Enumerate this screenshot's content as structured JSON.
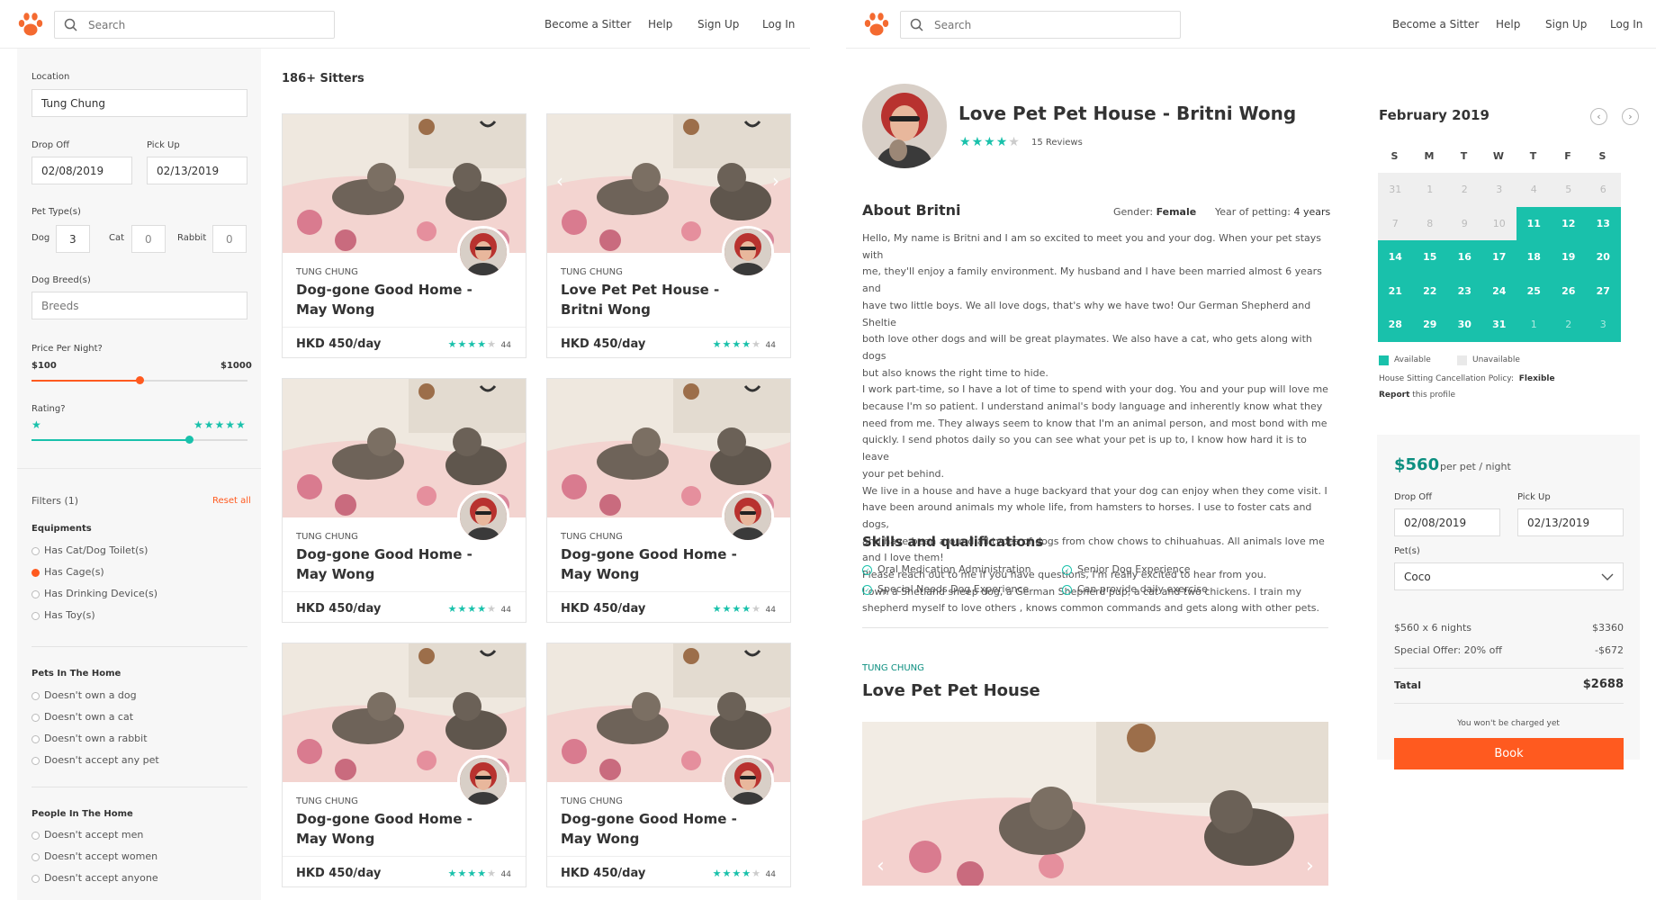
{
  "colors": {
    "accent": "#ff5a1f",
    "teal": "#19c1ab",
    "brand_orange": "#f46a30"
  },
  "header": {
    "search_placeholder": "Search",
    "nav": [
      "Become a Sitter",
      "Help",
      "Sign Up",
      "Log In"
    ]
  },
  "filters": {
    "location_label": "Location",
    "location_value": "Tung Chung",
    "dropoff_label": "Drop Off",
    "dropoff_value": "02/08/2019",
    "pickup_label": "Pick Up",
    "pickup_value": "02/13/2019",
    "pet_types_label": "Pet Type(s)",
    "dog_label": "Dog",
    "dog_count": "3",
    "cat_label": "Cat",
    "cat_count": "0",
    "rabbit_label": "Rabbit",
    "rabbit_count": "0",
    "breeds_label": "Dog Breed(s)",
    "breeds_placeholder": "Breeds",
    "price_label": "Price Per Night?",
    "price_min": "$100",
    "price_max": "$1000",
    "price_fraction": 0.5,
    "rating_label": "Rating?",
    "rating_fraction": 0.73,
    "filters_count": "Filters (1)",
    "reset": "Reset all",
    "equipments_label": "Equipments",
    "equipments": [
      "Has Cat/Dog Toilet(s)",
      "Has Cage(s)",
      "Has Drinking Device(s)",
      "Has Toy(s)"
    ],
    "equipments_selected": 1,
    "pets_label": "Pets In The Home",
    "pets": [
      "Doesn't own a dog",
      "Doesn't own a cat",
      "Doesn't own a rabbit",
      "Doesn't accept any pet"
    ],
    "people_label": "People In The Home",
    "people": [
      "Doesn't accept men",
      "Doesn't accept women",
      "Doesn't accept anyone"
    ]
  },
  "results": {
    "count": "186+ Sitters",
    "cards": [
      {
        "location": "TUNG CHUNG",
        "title": "Dog-gone Good Home - May Wong",
        "price": "HKD 450/day",
        "reviews": "44",
        "rating": 4
      },
      {
        "location": "TUNG CHUNG",
        "title": "Love Pet Pet House - Britni Wong",
        "price": "HKD 450/day",
        "reviews": "44",
        "rating": 4
      },
      {
        "location": "TUNG CHUNG",
        "title": "Dog-gone Good Home - May Wong",
        "price": "HKD 450/day",
        "reviews": "44",
        "rating": 4
      },
      {
        "location": "TUNG CHUNG",
        "title": "Dog-gone Good Home - May Wong",
        "price": "HKD 450/day",
        "reviews": "44",
        "rating": 4
      },
      {
        "location": "TUNG CHUNG",
        "title": "Dog-gone Good Home - May Wong",
        "price": "HKD 450/day",
        "reviews": "44",
        "rating": 4
      },
      {
        "location": "TUNG CHUNG",
        "title": "Dog-gone Good Home - May Wong",
        "price": "HKD 450/day",
        "reviews": "44",
        "rating": 4
      }
    ]
  },
  "profile": {
    "name": "Love Pet Pet House - Britni Wong",
    "reviews": "15 Reviews",
    "rating": 4,
    "about_title": "About Britni",
    "gender_label": "Gender:",
    "gender_value": "Female",
    "years_label": "Year of petting:",
    "years_value": "4 years",
    "about_lines": [
      "Hello, My name is Britni and I am so excited to meet you and your dog. When your pet stays with",
      "me, they'll enjoy a family environment. My husband and I have been married almost 6 years and",
      "have two little boys. We all love dogs, that's why we have two! Our German Shepherd and Sheltie",
      "both love other dogs and will be great playmates. We also have a cat, who gets along with dogs",
      "but also knows the right time to hide.",
      "I work part-time, so I have a lot of time to spend with your dog. You and your pup will love me",
      "because I'm so patient. I understand animal's body language and inherently know what they",
      "need from me. They always seem to know that I'm an animal person, and most bond with me",
      "quickly. I send photos daily so you can see what your pet is up to, I know how hard it is to leave",
      "your pet behind.",
      "We live in a house and have a huge backyard that your dog can enjoy when they come visit. I",
      "have been around animals my whole life, from hamsters to horses. I use to foster cats and dogs,",
      "and have been around all types of dogs from chow chows to chihuahuas. All animals love me",
      "and I love them!",
      "Please reach out to me if you have questions, I'm really excited to hear from you.",
      "I own a Shetland sheep dog, a German Shepherd pup, a cat and two chickens. I train my",
      "shepherd myself to love others , knows common commands and gets along with other pets."
    ],
    "skills_title": "Skills and qualifications",
    "skills": [
      "Oral Medication Administration",
      "Special Needs Dog Experience",
      "Senior Dog Experience",
      "Can provide daily exercise"
    ],
    "house_location": "TUNG CHUNG",
    "house_title": "Love Pet Pet House"
  },
  "calendar": {
    "month": "February 2019",
    "weekdays": [
      "S",
      "M",
      "T",
      "W",
      "T",
      "F",
      "S"
    ],
    "weeks": [
      [
        "31",
        "1",
        "2",
        "3",
        "4",
        "5",
        "6"
      ],
      [
        "7",
        "8",
        "9",
        "10",
        "11",
        "12",
        "13"
      ],
      [
        "14",
        "15",
        "16",
        "17",
        "18",
        "19",
        "20"
      ],
      [
        "21",
        "22",
        "23",
        "24",
        "25",
        "26",
        "27"
      ],
      [
        "28",
        "29",
        "30",
        "31",
        "1",
        "2",
        "3"
      ]
    ],
    "available_from_index": 11,
    "legend_available": "Available",
    "legend_unavailable": "Unavailable",
    "policy_label": "House Sitting Cancellation Policy:",
    "policy_value": "Flexible",
    "report": "Report",
    "report_suffix": "this profile"
  },
  "booking": {
    "price": "$560",
    "price_suffix": "per pet / night",
    "dropoff_label": "Drop Off",
    "dropoff_value": "02/08/2019",
    "pickup_label": "Pick Up",
    "pickup_value": "02/13/2019",
    "pets_label": "Pet(s)",
    "pets_value": "Coco",
    "line1_label": "$560 x 6 nights",
    "line1_value": "$3360",
    "line2_label": "Special Offer: 20% off",
    "line2_value": "-$672",
    "total_label": "Tatal",
    "total_value": "$2688",
    "note": "You won't be charged yet",
    "book": "Book"
  }
}
